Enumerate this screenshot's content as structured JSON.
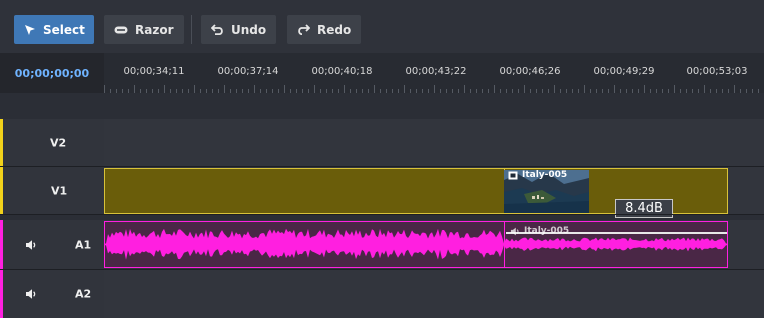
{
  "toolbar": {
    "select_label": "Select",
    "razor_label": "Razor",
    "undo_label": "Undo",
    "redo_label": "Redo"
  },
  "timeline": {
    "current_time": "00;00;00;00",
    "ticks": [
      "00;00;34;11",
      "00;00;37;14",
      "00;00;40;18",
      "00;00;43;22",
      "00;00;46;26",
      "00;00;49;29",
      "00;00;53;03"
    ]
  },
  "tracks": {
    "v2_label": "V2",
    "v1_label": "V1",
    "a1_label": "A1",
    "a2_label": "A2"
  },
  "clips": {
    "video_title": "Italy-005",
    "audio_title": "Italy-005",
    "gain": "8.4dB"
  },
  "colors": {
    "accent": "#3f78b6",
    "timecode": "#6fb3ff",
    "video_marker": "#f2d21b",
    "audio_marker": "#ff20e0",
    "waveform": "#ff1fe0",
    "video_clip": "#6a5d0a"
  }
}
